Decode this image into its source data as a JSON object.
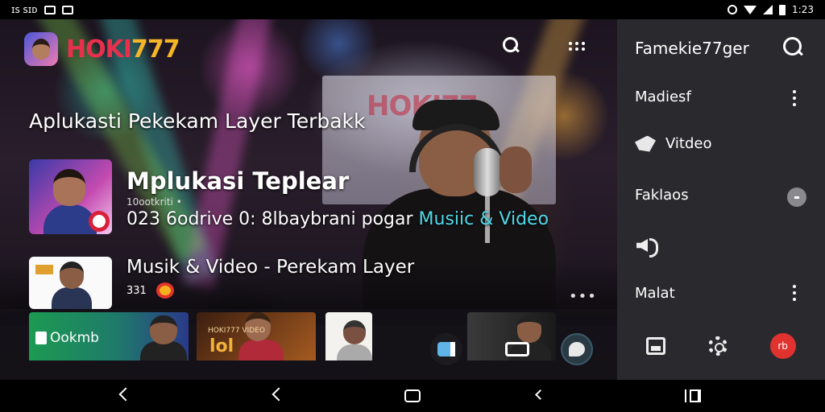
{
  "status_bar": {
    "left_text": "ɪꜱ ꜱɪᴅ",
    "time": "1:23"
  },
  "app": {
    "brand_red": "HOKI",
    "brand_yellow": "777",
    "brand_red_color": "#e8304d",
    "brand_yellow_color": "#f4b526"
  },
  "hero": {
    "stage_logo": "HOKI77",
    "headline": "Aplukasti Pekekam Layer Terbakk"
  },
  "featured": {
    "title": "Mplukasi Teplear",
    "subtitle": "10ootkriti •",
    "desc_prefix": "023 6odrive 0: 8lbaybrani pogar ",
    "desc_highlight": "Musiic & Video",
    "highlight_color": "#4fd8e8"
  },
  "second": {
    "title": "Musik & Video - Perekam Layer",
    "meta": "331",
    "more": "•••"
  },
  "cards": [
    {
      "label": "Ookmb"
    },
    {
      "tag": "HOKI777 VIDEO",
      "big": "lol"
    }
  ],
  "drawer": {
    "header": "Famekie77ger",
    "items": [
      {
        "label": "Madiesf"
      },
      {
        "label": "Vitdeo"
      },
      {
        "label": "Faklaos"
      },
      {
        "label": "Malat"
      }
    ],
    "record_badge": "rb",
    "record_color": "#e0322f"
  },
  "icons": [
    "search-icon",
    "grid-icon",
    "more-vert-icon",
    "play-icon",
    "toggle-icon",
    "speaker-icon",
    "gallery-icon",
    "settings-icon",
    "record-icon",
    "back-icon",
    "home-icon",
    "recents-icon"
  ]
}
